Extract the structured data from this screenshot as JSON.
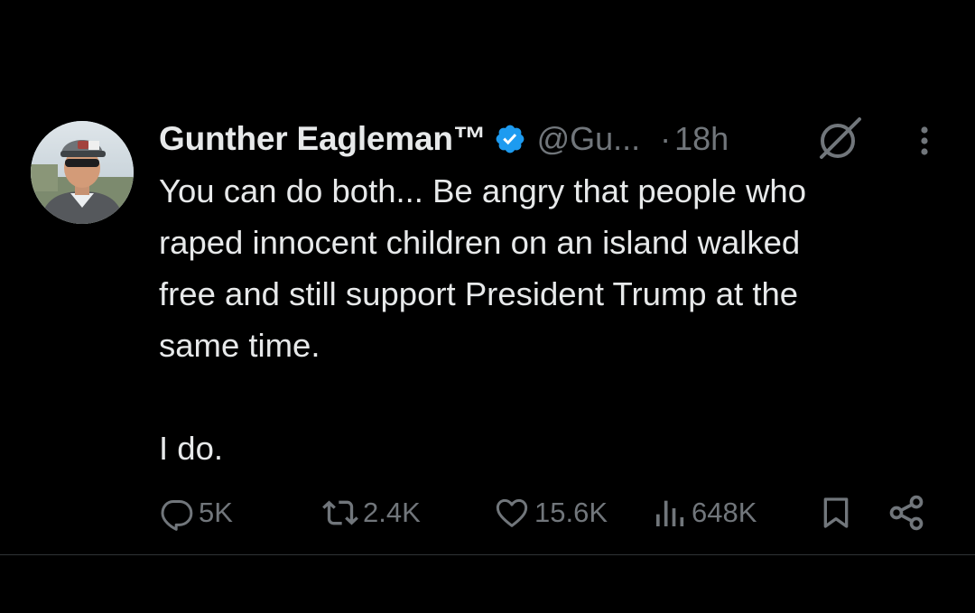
{
  "post": {
    "author": {
      "display_name": "Gunther Eagleman™",
      "handle": "@Gu...",
      "verified": true,
      "verified_color": "#1d9bf0"
    },
    "separator": "·",
    "time": "18h",
    "text": "You can do both... Be angry that people who\nraped innocent children on an island walked\nfree and still support President Trump at the\nsame time.\n\nI do.",
    "actions": {
      "replies": "5K",
      "reposts": "2.4K",
      "likes": "15.6K",
      "views": "648K"
    },
    "icons": {
      "avatar": "avatar",
      "verified": "verified-badge-icon",
      "grok": "grok-icon",
      "more": "more-vertical-icon",
      "reply": "reply-icon",
      "repost": "repost-icon",
      "like": "heart-icon",
      "views": "views-chart-icon",
      "bookmark": "bookmark-icon",
      "share": "share-icon"
    }
  },
  "theme": {
    "background": "#000000",
    "text_primary": "#e7e9ea",
    "text_secondary": "#71767b",
    "divider": "#2f3336"
  }
}
